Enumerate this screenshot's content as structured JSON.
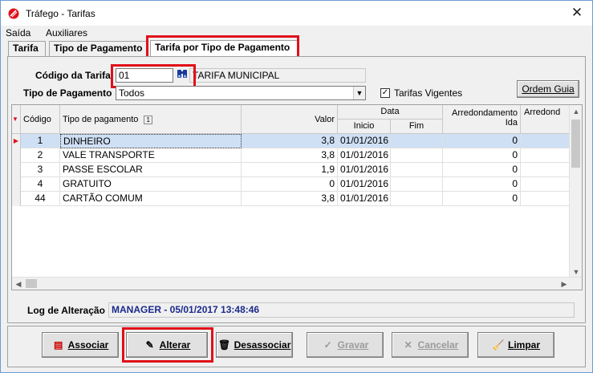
{
  "window": {
    "title": "Tráfego - Tarifas",
    "close_glyph": "✕"
  },
  "menu": [
    "Saída",
    "Auxiliares"
  ],
  "tabs": [
    {
      "label": "Tarifa"
    },
    {
      "label": "Tipo de Pagamento"
    },
    {
      "label": "Tarifa por Tipo de Pagamento"
    }
  ],
  "form": {
    "codigo_label": "Código da Tarifa",
    "codigo_value": "01",
    "tarifa_desc": "TARIFA MUNICIPAL",
    "tipo_label": "Tipo de Pagamento",
    "tipo_value": "Todos",
    "vigentes_label": "Tarifas Vigentes",
    "vigentes_checked": true,
    "ordem_button": "Ordem Guia"
  },
  "grid": {
    "headers": {
      "codigo": "Código",
      "tipo": "Tipo de pagamento",
      "sort_badge": "1",
      "valor": "Valor",
      "data": "Data",
      "inicio": "Inicio",
      "fim": "Fim",
      "arred_ida": "Arredondamento Ida",
      "arred_volta": "Arredond"
    },
    "rows": [
      {
        "codigo": "1",
        "tipo": "DINHEIRO",
        "valor": "3,8",
        "inicio": "01/01/2016",
        "fim": "",
        "arred": "0"
      },
      {
        "codigo": "2",
        "tipo": "VALE TRANSPORTE",
        "valor": "3,8",
        "inicio": "01/01/2016",
        "fim": "",
        "arred": "0"
      },
      {
        "codigo": "3",
        "tipo": "PASSE ESCOLAR",
        "valor": "1,9",
        "inicio": "01/01/2016",
        "fim": "",
        "arred": "0"
      },
      {
        "codigo": "4",
        "tipo": "GRATUITO",
        "valor": "0",
        "inicio": "01/01/2016",
        "fim": "",
        "arred": "0"
      },
      {
        "codigo": "44",
        "tipo": "CARTÃO COMUM",
        "valor": "3,8",
        "inicio": "01/01/2016",
        "fim": "",
        "arred": "0"
      }
    ]
  },
  "log": {
    "label": "Log de Alteração",
    "value": "MANAGER - 05/01/2017 13:48:46"
  },
  "buttons": {
    "associar": "Associar",
    "alterar": "Alterar",
    "desassociar": "Desassociar",
    "gravar": "Gravar",
    "cancelar": "Cancelar",
    "limpar": "Limpar"
  },
  "colors": {
    "highlight_red": "#e0101a",
    "selection": "#cfe0f5",
    "log_text": "#1a2a8c"
  }
}
